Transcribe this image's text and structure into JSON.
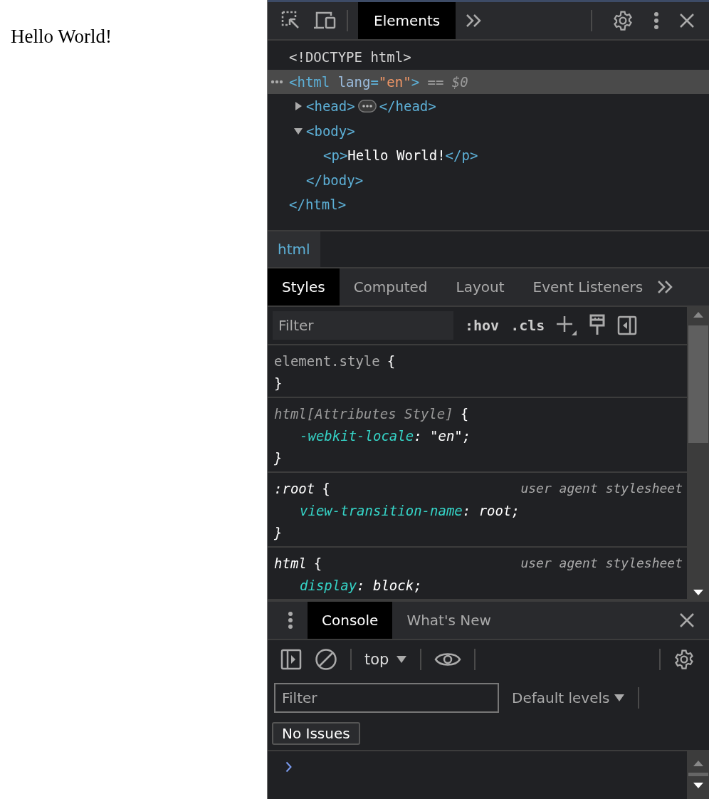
{
  "page": {
    "paragraph": "Hello World!"
  },
  "devtools": {
    "main_tabs": [
      {
        "label": "Elements",
        "selected": true
      }
    ],
    "dom_tree": [
      {
        "tokens": [
          {
            "kind": "doctype",
            "text": "<!DOCTYPE html>"
          }
        ],
        "selected": false
      },
      {
        "tokens": [
          {
            "kind": "tag",
            "text": "<html"
          },
          {
            "kind": "attr",
            "text": " lang"
          },
          {
            "kind": "tag",
            "text": "="
          },
          {
            "kind": "value",
            "text": "\"en\""
          },
          {
            "kind": "tag",
            "text": ">"
          },
          {
            "kind": "marker",
            "text": " == $0"
          }
        ],
        "selected": true,
        "children": [
          {
            "tokens": [
              {
                "kind": "tag",
                "text": "<head>"
              }
            ],
            "ellipsis": true,
            "tail_tokens": [
              {
                "kind": "tag",
                "text": "</head>"
              }
            ],
            "expanded": false,
            "selected": false
          },
          {
            "tokens": [
              {
                "kind": "tag",
                "text": "<body>"
              }
            ],
            "expanded": true,
            "selected": false,
            "children": [
              {
                "tokens": [
                  {
                    "kind": "tag",
                    "text": "<p>"
                  },
                  {
                    "kind": "text",
                    "text": "Hello World!"
                  },
                  {
                    "kind": "tag",
                    "text": "</p>"
                  }
                ],
                "selected": false
              }
            ],
            "closing": "</body>"
          }
        ],
        "closing": "</html>"
      }
    ],
    "breadcrumb": [
      {
        "label": "html",
        "selected": true
      }
    ],
    "style_tabs": [
      {
        "label": "Styles",
        "selected": true
      },
      {
        "label": "Computed",
        "selected": false
      },
      {
        "label": "Layout",
        "selected": false
      },
      {
        "label": "Event Listeners",
        "selected": false
      }
    ],
    "styles_filter": {
      "placeholder": "Filter"
    },
    "styles_toggles": [
      ":hov",
      ".cls"
    ],
    "rules": [
      {
        "kind": "inline",
        "selector": "element.style",
        "open": "{",
        "close": "}"
      },
      {
        "kind": "attributes",
        "selector": "html[Attributes Style]",
        "open": "{",
        "declarations": [
          {
            "property": "-webkit-locale",
            "value": ": \"en\";"
          }
        ],
        "close": "}"
      },
      {
        "kind": "user_agent",
        "selector": ":root",
        "open": "{",
        "origin": "user agent stylesheet",
        "declarations": [
          {
            "property": "view-transition-name",
            "value": ": root;"
          }
        ],
        "close": "}"
      },
      {
        "kind": "user_agent",
        "selector": "html",
        "open": "{",
        "origin": "user agent stylesheet",
        "declarations": [
          {
            "property": "display",
            "value": ": block;"
          }
        ]
      }
    ],
    "drawer_tabs": [
      {
        "label": "Console",
        "selected": true
      },
      {
        "label": "What's New",
        "selected": false
      }
    ],
    "console": {
      "context": "top",
      "filter": {
        "placeholder": "Filter"
      },
      "levels": "Default levels",
      "issues": "No Issues"
    }
  }
}
